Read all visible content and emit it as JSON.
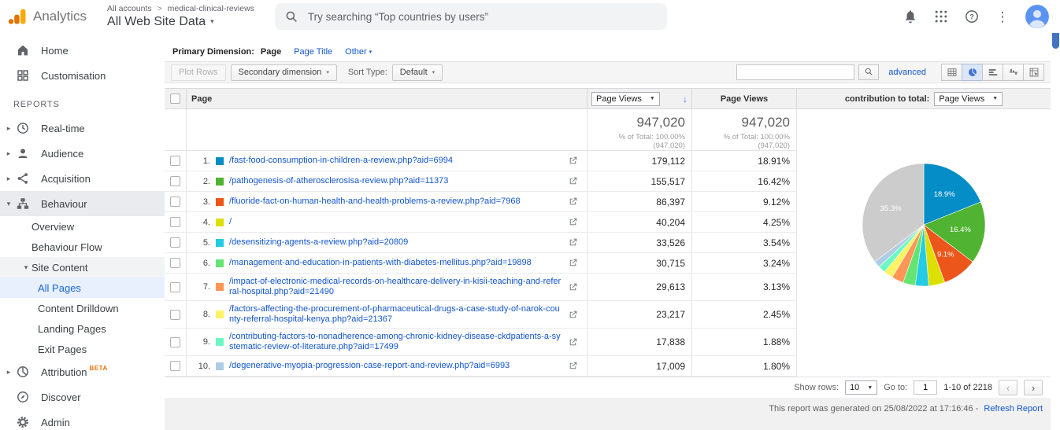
{
  "header": {
    "product_name": "Analytics",
    "breadcrumb": {
      "account_level": "All accounts",
      "separator": ">",
      "property_name": "medical-clinical-reviews"
    },
    "view_name": "All Web Site Data",
    "search_placeholder": "Try searching “Top countries by users”",
    "icons": [
      "notifications-icon",
      "apps-grid-icon",
      "help-icon",
      "more-vert-icon",
      "avatar"
    ]
  },
  "sidebar": {
    "items": [
      {
        "label": "Home",
        "icon": "home-icon",
        "level": 0
      },
      {
        "label": "Customisation",
        "icon": "customisation-icon",
        "level": 0
      },
      {
        "section": "REPORTS"
      },
      {
        "label": "Real-time",
        "icon": "realtime-icon",
        "level": 0,
        "arrow": "collapsed"
      },
      {
        "label": "Audience",
        "icon": "audience-icon",
        "level": 0,
        "arrow": "collapsed"
      },
      {
        "label": "Acquisition",
        "icon": "acquisition-icon",
        "level": 0,
        "arrow": "collapsed"
      },
      {
        "label": "Behaviour",
        "icon": "behaviour-icon",
        "level": 0,
        "arrow": "expanded",
        "state": "active-section"
      },
      {
        "label": "Overview",
        "level": 2
      },
      {
        "label": "Behaviour Flow",
        "level": 2
      },
      {
        "label": "Site Content",
        "level": 2,
        "arrow": "expanded",
        "state": "active-group"
      },
      {
        "label": "All Pages",
        "level": 3,
        "state": "selected"
      },
      {
        "label": "Content Drilldown",
        "level": 3
      },
      {
        "label": "Landing Pages",
        "level": 3
      },
      {
        "label": "Exit Pages",
        "level": 3
      },
      {
        "label": "Attribution",
        "badge": "BETA",
        "icon": "attribution-icon",
        "level": 0,
        "arrow": "collapsed"
      },
      {
        "label": "Discover",
        "icon": "discover-icon",
        "level": 0
      },
      {
        "label": "Admin",
        "icon": "admin-icon",
        "level": 0
      }
    ]
  },
  "primary_dimension": {
    "label": "Primary Dimension:",
    "selected": "Page",
    "link1": "Page Title",
    "link2": "Other"
  },
  "toolbar": {
    "plot_rows_label": "Plot Rows",
    "secondary_dimension_label": "Secondary dimension",
    "sort_type_label": "Sort Type:",
    "sort_type_value": "Default",
    "advanced_label": "advanced",
    "views": [
      {
        "icon": "table-view-icon",
        "active": false
      },
      {
        "icon": "percentage-view-icon",
        "active": true
      },
      {
        "icon": "performance-view-icon",
        "active": false
      },
      {
        "icon": "comparison-view-icon",
        "active": false
      },
      {
        "icon": "pivot-view-icon",
        "active": false
      }
    ]
  },
  "table": {
    "columns": {
      "page": "Page",
      "metric_select": "Page Views",
      "page_views": "Page Views",
      "contribution_label": "contribution to total:",
      "contribution_select": "Page Views"
    },
    "summary": {
      "metric_total": "947,020",
      "metric_total_sub": "% of Total: 100.00% (947,020)",
      "views_total": "947,020",
      "views_total_sub": "% of Total: 100.00% (947,020)"
    },
    "rows": [
      {
        "rank": "1.",
        "color": "#058dc7",
        "page": "/fast-food-consumption-in-children-a-review.php?aid=6994",
        "views": "179,112",
        "pct": "18.91%"
      },
      {
        "rank": "2.",
        "color": "#50b432",
        "page": "/pathogenesis-of-atherosclerosisa-review.php?aid=11373",
        "views": "155,517",
        "pct": "16.42%"
      },
      {
        "rank": "3.",
        "color": "#ed561b",
        "page": "/fluoride-fact-on-human-health-and-health-problems-a-review.php?aid=7968",
        "views": "86,397",
        "pct": "9.12%"
      },
      {
        "rank": "4.",
        "color": "#dddf00",
        "page": "/",
        "views": "40,204",
        "pct": "4.25%"
      },
      {
        "rank": "5.",
        "color": "#24cbe5",
        "page": "/desensitizing-agents-a-review.php?aid=20809",
        "views": "33,526",
        "pct": "3.54%"
      },
      {
        "rank": "6.",
        "color": "#64e572",
        "page": "/management-and-education-in-patients-with-diabetes-mellitus.php?aid=19898",
        "views": "30,715",
        "pct": "3.24%"
      },
      {
        "rank": "7.",
        "color": "#ff9655",
        "page": "/impact-of-electronic-medical-records-on-healthcare-delivery-in-kisii-teaching-and-referral-hospital.php?aid=21490",
        "views": "29,613",
        "pct": "3.13%"
      },
      {
        "rank": "8.",
        "color": "#fff263",
        "page": "/factors-affecting-the-procurement-of-pharmaceutical-drugs-a-case-study-of-narok-county-referral-hospital-kenya.php?aid=21367",
        "views": "23,217",
        "pct": "2.45%"
      },
      {
        "rank": "9.",
        "color": "#6af9c4",
        "page": "/contributing-factors-to-nonadherence-among-chronic-kidney-disease-ckdpatients-a-systematic-review-of-literature.php?aid=17499",
        "views": "17,838",
        "pct": "1.88%"
      },
      {
        "rank": "10.",
        "color": "#aecde4",
        "page": "/degenerative-myopia-progression-case-report-and-review.php?aid=6993",
        "views": "17,009",
        "pct": "1.80%"
      }
    ]
  },
  "footer": {
    "show_rows_label": "Show rows:",
    "show_rows_value": "10",
    "goto_label": "Go to:",
    "goto_value": "1",
    "range_text": "1-10 of 2218",
    "generated_text": "This report was generated on 25/08/2022 at 17:16:46 -",
    "refresh_label": "Refresh Report"
  },
  "chart_data": {
    "type": "pie",
    "title": "contribution to total: Page Views",
    "legend_position": "none",
    "slices": [
      {
        "name": "/fast-food-consumption-in-children-a-review.php?aid=6994",
        "value": 18.91,
        "label": "18.9%",
        "color": "#058dc7"
      },
      {
        "name": "/pathogenesis-of-atherosclerosisa-review.php?aid=11373",
        "value": 16.42,
        "label": "16.4%",
        "color": "#50b432"
      },
      {
        "name": "/fluoride-fact-on-human-health-and-health-problems-a-review.php?aid=7968",
        "value": 9.12,
        "label": "9.1%",
        "color": "#ed561b"
      },
      {
        "name": "/",
        "value": 4.25,
        "color": "#dddf00"
      },
      {
        "name": "/desensitizing-agents-a-review.php?aid=20809",
        "value": 3.54,
        "color": "#24cbe5"
      },
      {
        "name": "/management-and-education-in-patients-with-diabetes-mellitus.php?aid=19898",
        "value": 3.24,
        "color": "#64e572"
      },
      {
        "name": "/impact-of-electronic-medical-records-on-healthcare-delivery-in-kisii-teaching-and-referral-hospital.php?aid=21490",
        "value": 3.13,
        "color": "#ff9655"
      },
      {
        "name": "/factors-affecting-the-procurement-of-pharmaceutical-drugs-a-case-study-of-narok-county-referral-hospital-kenya.php?aid=21367",
        "value": 2.45,
        "color": "#fff263"
      },
      {
        "name": "/contributing-factors-to-nonadherence-among-chronic-kidney-disease-ckdpatients-a-systematic-review-of-literature.php?aid=17499",
        "value": 1.88,
        "color": "#6af9c4"
      },
      {
        "name": "/degenerative-myopia-progression-case-report-and-review.php?aid=6993",
        "value": 1.8,
        "color": "#aecde4"
      },
      {
        "name": "others",
        "value": 35.26,
        "label": "35.3%",
        "color": "#cccccc"
      }
    ]
  }
}
